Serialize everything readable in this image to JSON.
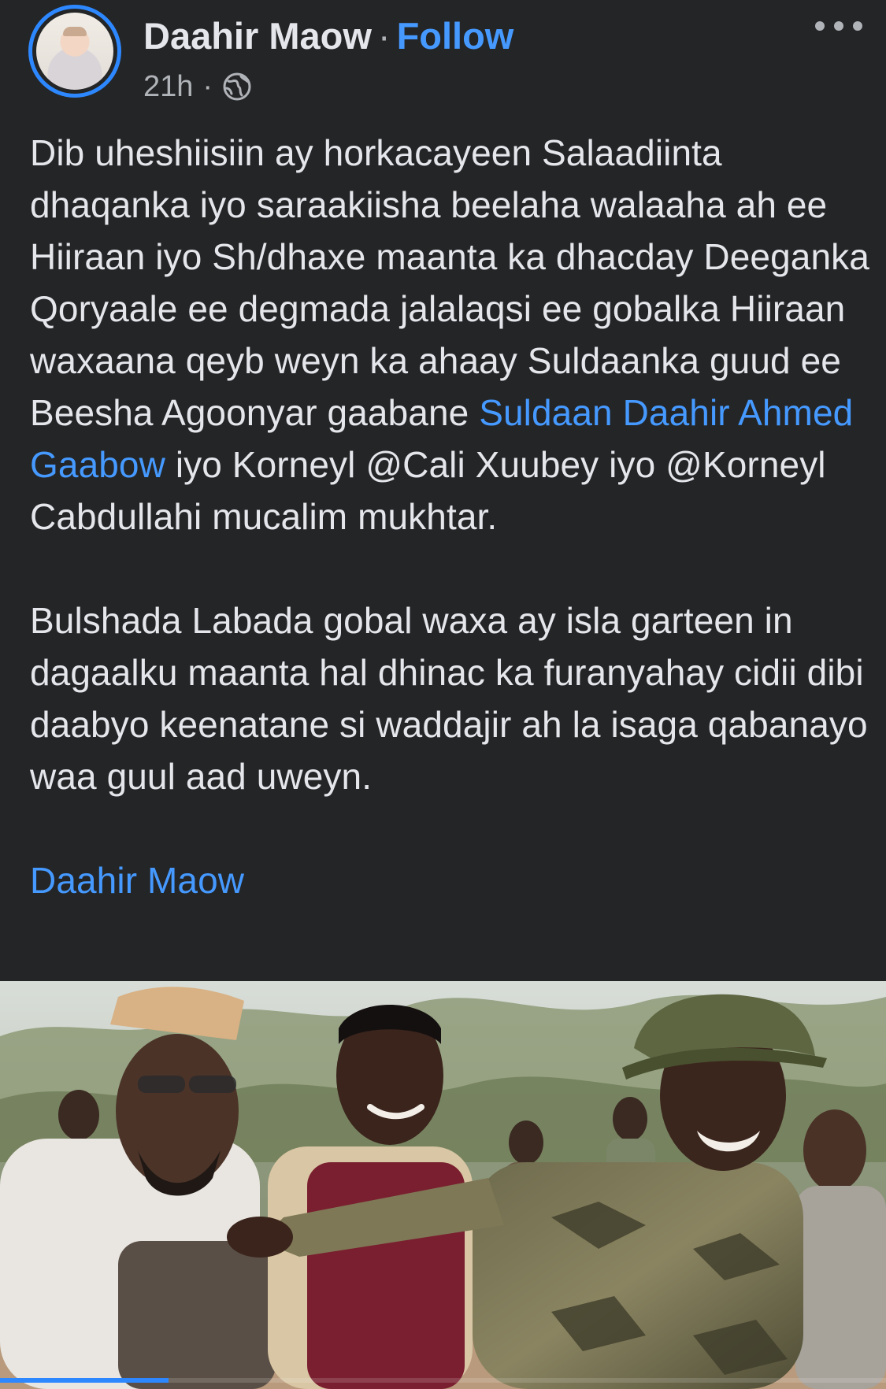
{
  "post": {
    "author": "Daahir Maow",
    "separator": "·",
    "follow_label": "Follow",
    "time": "21h",
    "time_separator": "·",
    "privacy_icon": "globe-icon",
    "more_icon": "more-options-icon",
    "text": {
      "p1_a": "Dib uheshiisiin ay horkacayeen Salaadiinta dhaqanka  iyo saraakiisha  beelaha walaaha ah ee Hiiraan iyo Sh/dhaxe maanta ka dhacday Deeganka Qoryaale ee degmada jalalaqsi ee gobalka Hiiraan waxaana qeyb weyn ka ahaay Suldaanka guud ee Beesha Agoonyar gaabane ",
      "p1_link": "Suldaan Daahir Ahmed Gaabow",
      "p1_b": " iyo Korneyl @Cali Xuubey  iyo @Korneyl Cabdullahi mucalim mukhtar.",
      "p2": "Bulshada Labada gobal waxa ay isla garteen in dagaalku maanta hal dhinac ka furanyahay cidii dibi daabyo keenatane si waddajir ah la isaga qabanayo waa guul aad uweyn.",
      "signature_link": "Daahir Maow"
    },
    "photo": {
      "icon": "post-photo"
    },
    "video_progress": 0.19
  },
  "colors": {
    "background": "#242526",
    "text": "#e4e6eb",
    "secondary": "#b0b3b8",
    "link": "#4599ff",
    "accent": "#2d88ff"
  }
}
